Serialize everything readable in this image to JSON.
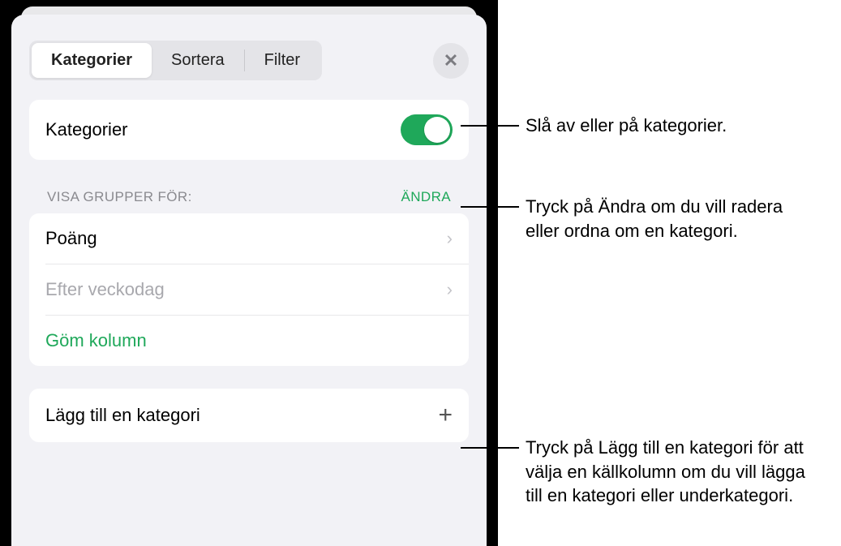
{
  "tabs": {
    "categories": "Kategorier",
    "sort": "Sortera",
    "filter": "Filter"
  },
  "toggle_row": {
    "label": "Kategorier"
  },
  "groups_header": {
    "label": "VISA GRUPPER FÖR:",
    "edit": "ÄNDRA"
  },
  "groups": {
    "item1": "Poäng",
    "item2": "Efter veckodag",
    "hide": "Göm kolumn"
  },
  "add_row": {
    "label": "Lägg till en kategori"
  },
  "callouts": {
    "c1": "Slå av eller på kategorier.",
    "c2": "Tryck på Ändra om du vill radera eller ordna om en kategori.",
    "c3": "Tryck på Lägg till en kategori för att välja en källkolumn om du vill lägga till en kategori eller underkategori."
  }
}
